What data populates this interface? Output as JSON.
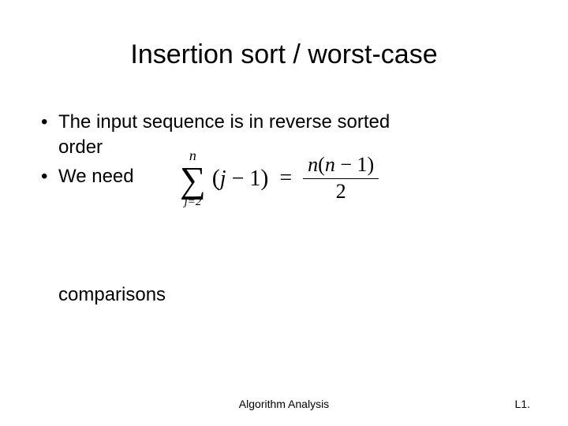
{
  "title": "Insertion sort / worst-case",
  "bullet1_line1": "The input sequence  is in reverse sorted",
  "bullet1_line2": "order",
  "bullet2": "We need",
  "comparisons": "comparisons",
  "formula": {
    "upper": "n",
    "lower": "j=2",
    "summand_open": "(",
    "summand_var": "j",
    "summand_minus": " − 1",
    "summand_close": ")",
    "equals": "=",
    "numerator_n1": "n",
    "numerator_open": "(",
    "numerator_n2": "n",
    "numerator_rest": " − 1)",
    "denominator": "2"
  },
  "footer_center": "Algorithm Analysis",
  "footer_right": "L1."
}
